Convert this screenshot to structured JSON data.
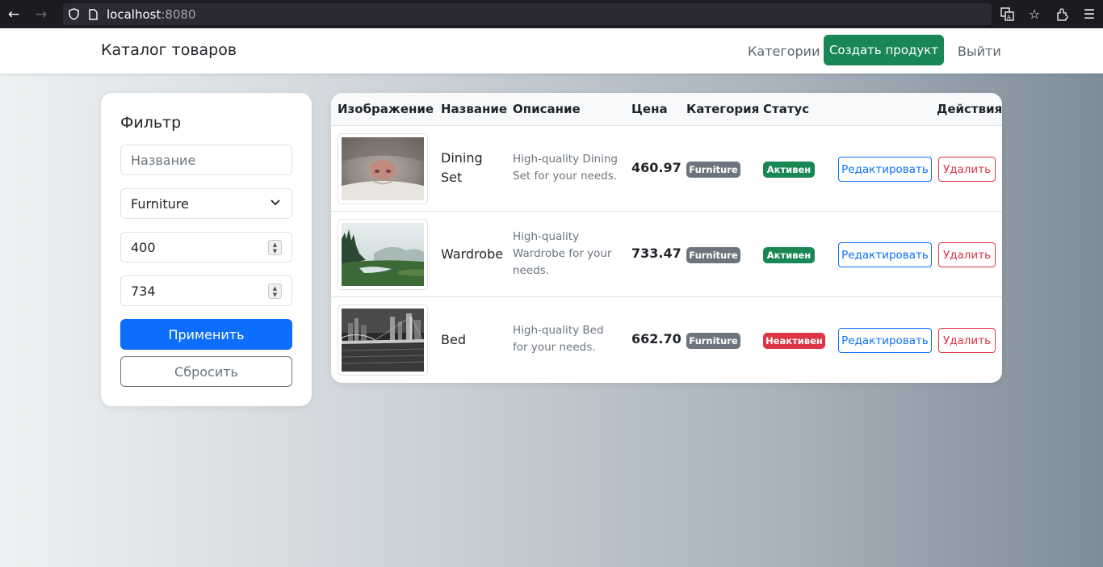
{
  "browser": {
    "host": "localhost",
    "port": ":8080"
  },
  "navbar": {
    "brand": "Каталог товаров",
    "categories_link": "Категории",
    "create_button": "Создать продукт",
    "logout_link": "Выйти"
  },
  "filter": {
    "title": "Фильтр",
    "name_placeholder": "Название",
    "category_selected": "Furniture",
    "min_price": "400",
    "max_price": "734",
    "apply_button": "Применить",
    "reset_button": "Сбросить"
  },
  "table": {
    "headers": [
      "Изображение",
      "Название",
      "Описание",
      "Цена",
      "Категория",
      "Статус",
      "Действия"
    ],
    "edit_label": "Редактировать",
    "delete_label": "Удалить",
    "rows": [
      {
        "name": "Dining Set",
        "description": "High-quality Dining Set for your needs.",
        "price": "460.97",
        "category": "Furniture",
        "status": "Активен",
        "image": "cat-nose-photo"
      },
      {
        "name": "Wardrobe",
        "description": "High-quality Wardrobe for your needs.",
        "price": "733.47",
        "category": "Furniture",
        "status": "Активен",
        "image": "misty-forest-lake-photo"
      },
      {
        "name": "Bed",
        "description": "High-quality Bed for your needs.",
        "price": "662.70",
        "category": "Furniture",
        "status": "Неактивен",
        "image": "night-bridge-city-photo"
      }
    ]
  },
  "colors": {
    "primary": "#0d6efd",
    "success": "#198754",
    "danger": "#dc3545",
    "secondary": "#6c757d"
  }
}
